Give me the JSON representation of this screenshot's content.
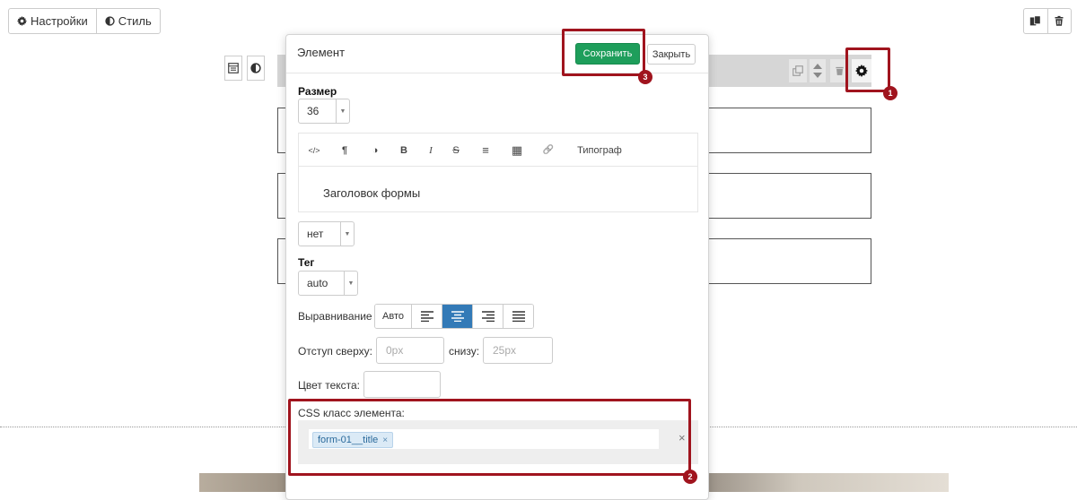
{
  "toolbar": {
    "settings_label": "Настройки",
    "style_label": "Стиль"
  },
  "modal": {
    "title": "Элемент",
    "save_label": "Сохранить",
    "close_label": "Закрыть",
    "size": {
      "label": "Размер",
      "value": "36"
    },
    "editor": {
      "tools": [
        "</>",
        "¶",
        "◑",
        "B",
        "I",
        "S",
        "≡",
        "▦",
        "🔗"
      ],
      "typograf_label": "Типограф",
      "content": "Заголовок формы"
    },
    "font_select": {
      "value": "нет"
    },
    "tag": {
      "label": "Тег",
      "value": "auto"
    },
    "alignment": {
      "label": "Выравнивание",
      "auto_label": "Авто",
      "selected": "center"
    },
    "margin": {
      "top_label": "Отступ сверху:",
      "top_placeholder": "0px",
      "bottom_label": "снизу:",
      "bottom_placeholder": "25px"
    },
    "text_color_label": "Цвет текста:",
    "css_class": {
      "label": "CSS класс элемента:",
      "tags": [
        "form-01__title"
      ],
      "clear_label": "×"
    }
  },
  "annotations": [
    "1",
    "2",
    "3"
  ],
  "colors": {
    "save": "#1e9e5b",
    "highlight": "#a0141e",
    "active_align": "#337ab7"
  }
}
